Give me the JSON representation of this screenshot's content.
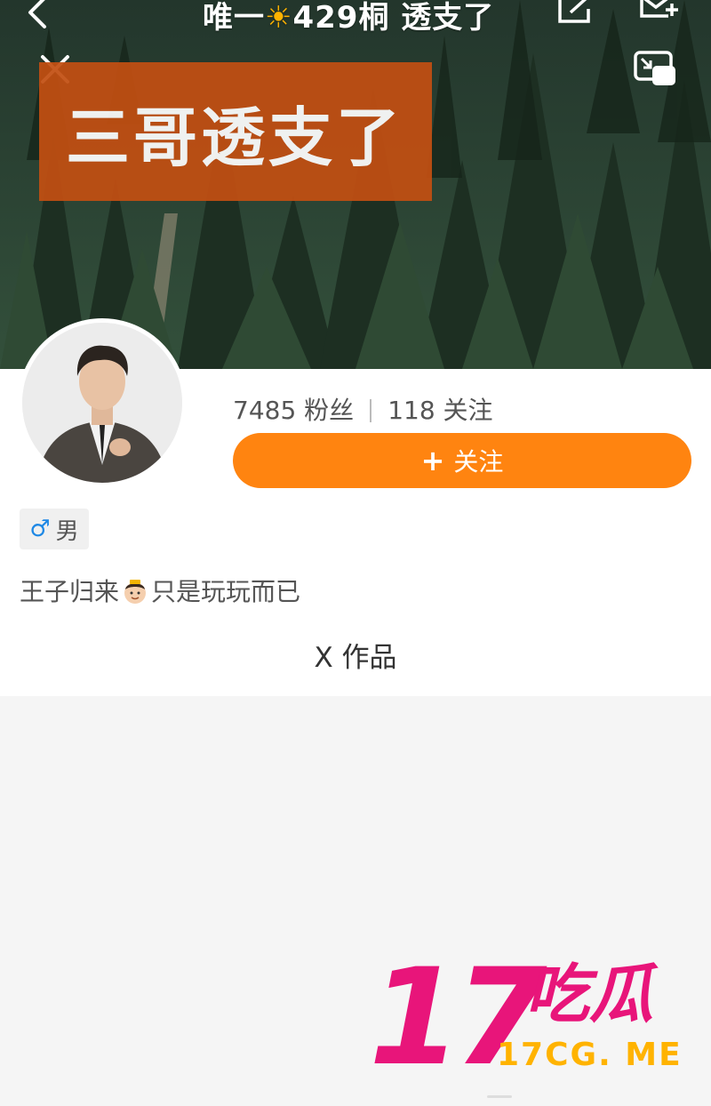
{
  "header": {
    "title_before": "唯一",
    "title_after": "429桐 透支了"
  },
  "banner": {
    "text": "三哥透支了"
  },
  "stats": {
    "fans_count": "7485",
    "fans_label": "粉丝",
    "following_count": "118",
    "following_label": "关注"
  },
  "follow_button": {
    "plus": "+",
    "label": "关注"
  },
  "gender": {
    "symbol": "♂",
    "label": "男"
  },
  "bio": {
    "before": "王子归来",
    "after": "只是玩玩而已"
  },
  "works": {
    "label": "X 作品"
  },
  "watermark": {
    "number": "17",
    "chinese": "吃瓜",
    "url": "17CG. ME"
  },
  "colors": {
    "accent": "#ff8410",
    "banner": "#c24f12",
    "watermark_pink": "#e8157a",
    "watermark_yellow": "#ffb300"
  },
  "icons": [
    "back-icon",
    "sun-icon",
    "share-icon",
    "mail-icon",
    "close-icon",
    "pip-icon",
    "male-icon",
    "emoji-icon"
  ]
}
